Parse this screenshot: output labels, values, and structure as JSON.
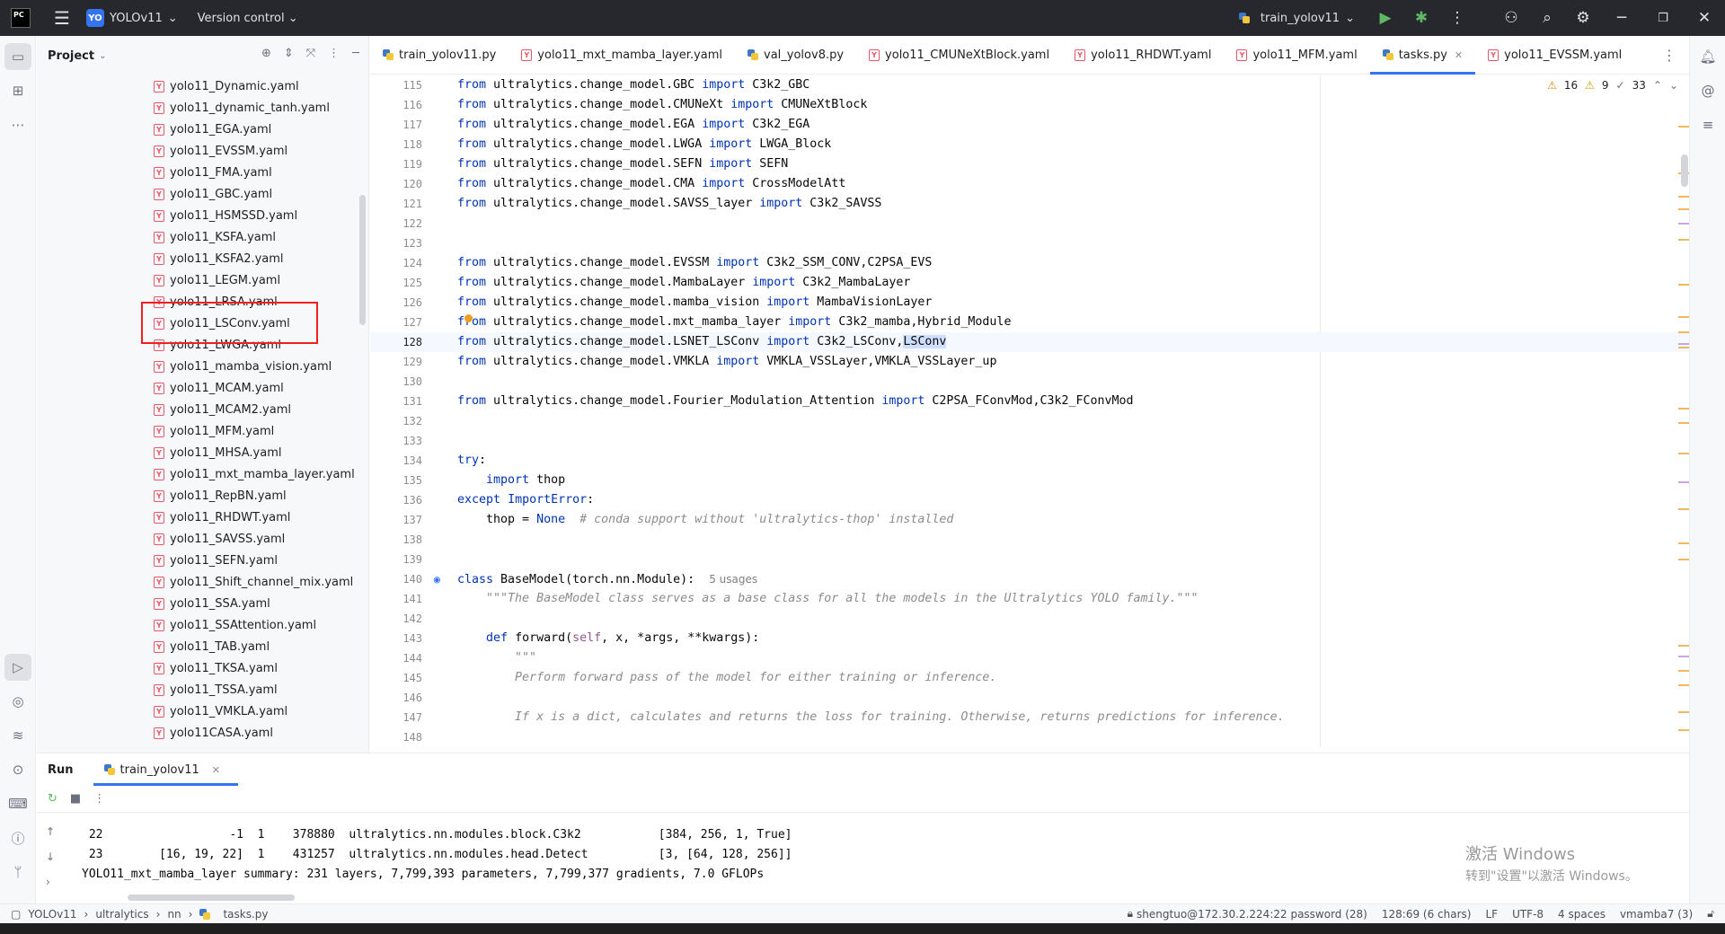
{
  "titlebar": {
    "project_badge": "YO",
    "project_name": "YOLOv11",
    "version_control": "Version control",
    "run_config": "train_yolov11"
  },
  "project_panel": {
    "title": "Project",
    "files": [
      "yolo11_Dynamic.yaml",
      "yolo11_dynamic_tanh.yaml",
      "yolo11_EGA.yaml",
      "yolo11_EVSSM.yaml",
      "yolo11_FMA.yaml",
      "yolo11_GBC.yaml",
      "yolo11_HSMSSD.yaml",
      "yolo11_KSFA.yaml",
      "yolo11_KSFA2.yaml",
      "yolo11_LEGM.yaml",
      "yolo11_LRSA.yaml",
      "yolo11_LSConv.yaml",
      "yolo11_LWGA.yaml",
      "yolo11_mamba_vision.yaml",
      "yolo11_MCAM.yaml",
      "yolo11_MCAM2.yaml",
      "yolo11_MFM.yaml",
      "yolo11_MHSA.yaml",
      "yolo11_mxt_mamba_layer.yaml",
      "yolo11_RepBN.yaml",
      "yolo11_RHDWT.yaml",
      "yolo11_SAVSS.yaml",
      "yolo11_SEFN.yaml",
      "yolo11_Shift_channel_mix.yaml",
      "yolo11_SSA.yaml",
      "yolo11_SSAttention.yaml",
      "yolo11_TAB.yaml",
      "yolo11_TKSA.yaml",
      "yolo11_TSSA.yaml",
      "yolo11_VMKLA.yaml",
      "yolo11CASA.yaml"
    ]
  },
  "tabs": [
    {
      "label": "train_yolov11.py",
      "kind": "py"
    },
    {
      "label": "yolo11_mxt_mamba_layer.yaml",
      "kind": "yaml"
    },
    {
      "label": "val_yolov8.py",
      "kind": "py"
    },
    {
      "label": "yolo11_CMUNeXtBlock.yaml",
      "kind": "yaml"
    },
    {
      "label": "yolo11_RHDWT.yaml",
      "kind": "yaml"
    },
    {
      "label": "yolo11_MFM.yaml",
      "kind": "yaml"
    },
    {
      "label": "tasks.py",
      "kind": "py",
      "active": true
    },
    {
      "label": "yolo11_EVSSM.yaml",
      "kind": "yaml"
    }
  ],
  "inspections": {
    "warnings": "16",
    "weak_warnings": "9",
    "typos": "33"
  },
  "editor": {
    "current_line": 128,
    "lines": [
      {
        "n": 115,
        "html": "<span class='kw'>from</span> ultralytics.change_model.GBC <span class='kw'>import</span> C3k2_GBC"
      },
      {
        "n": 116,
        "html": "<span class='kw'>from</span> ultralytics.change_model.CMUNeXt <span class='kw'>import</span> CMUNeXtBlock"
      },
      {
        "n": 117,
        "html": "<span class='kw'>from</span> ultralytics.change_model.EGA <span class='kw'>import</span> C3k2_EGA"
      },
      {
        "n": 118,
        "html": "<span class='kw'>from</span> ultralytics.change_model.LWGA <span class='kw'>import</span> LWGA_Block"
      },
      {
        "n": 119,
        "html": "<span class='kw'>from</span> ultralytics.change_model.SEFN <span class='kw'>import</span> SEFN"
      },
      {
        "n": 120,
        "html": "<span class='kw'>from</span> ultralytics.change_model.CMA <span class='kw'>import</span> CrossModelAtt"
      },
      {
        "n": 121,
        "html": "<span class='kw'>from</span> ultralytics.change_model.SAVSS_layer <span class='kw'>import</span> C3k2_SAVSS"
      },
      {
        "n": 122,
        "html": ""
      },
      {
        "n": 123,
        "html": ""
      },
      {
        "n": 124,
        "html": "<span class='kw'>from</span> ultralytics.change_model.EVSSM <span class='kw'>import</span> C3k2_SSM_CONV,C2PSA_EVS"
      },
      {
        "n": 125,
        "html": "<span class='kw'>from</span> ultralytics.change_model.MambaLayer <span class='kw'>import</span> C3k2_MambaLayer"
      },
      {
        "n": 126,
        "html": "<span class='kw'>from</span> ultralytics.change_model.mamba_vision <span class='kw'>import</span> MambaVisionLayer"
      },
      {
        "n": 127,
        "html": "<span class='kw'>from</span> ultralytics.change_model.mxt_mamba_layer <span class='kw'>import</span> C3k2_mamba,Hybrid_Module"
      },
      {
        "n": 128,
        "html": "<span class='kw'>from</span> ultralytics.change_model.LSNET_LSConv <span class='kw'>import</span> C3k2_LSConv,<span class='sel'>LSConv</span>"
      },
      {
        "n": 129,
        "html": "<span class='kw'>from</span> ultralytics.change_model.VMKLA <span class='kw'>import</span> VMKLA_VSSLayer,VMKLA_VSSLayer_up"
      },
      {
        "n": 130,
        "html": ""
      },
      {
        "n": 131,
        "html": "<span class='kw'>from</span> ultralytics.change_model.Fourier_Modulation_Attention <span class='kw'>import</span> C2PSA_FConvMod,C3k2_FConvMod"
      },
      {
        "n": 132,
        "html": ""
      },
      {
        "n": 133,
        "html": ""
      },
      {
        "n": 134,
        "html": "<span class='kw'>try</span>:"
      },
      {
        "n": 135,
        "html": "    <span class='kw'>import</span> thop"
      },
      {
        "n": 136,
        "html": "<span class='kw'>except</span> <span class='kw'>ImportError</span>:"
      },
      {
        "n": 137,
        "html": "    thop = <span class='kw'>None</span>  <span class='cm'># conda support without 'ultralytics-thop' installed</span>"
      },
      {
        "n": 138,
        "html": ""
      },
      {
        "n": 139,
        "html": ""
      },
      {
        "n": 140,
        "html": "<span class='kw'>class</span> BaseModel(torch.nn.Module):  <span class='hint'>5 usages</span>"
      },
      {
        "n": 141,
        "html": "    <span class='cm'>\"\"\"The BaseModel class serves as a base class for all the models in the Ultralytics YOLO family.\"\"\"</span>"
      },
      {
        "n": 142,
        "html": ""
      },
      {
        "n": 143,
        "html": "    <span class='kw'>def</span> forward(<span class='pm'>self</span>, x, *args, **kwargs):"
      },
      {
        "n": 144,
        "html": "        <span class='cm'>\"\"\"</span>"
      },
      {
        "n": 145,
        "html": "        <span class='cm'>Perform forward pass of the model for either training or inference.</span>"
      },
      {
        "n": 146,
        "html": ""
      },
      {
        "n": 147,
        "html": "        <span class='cm'>If x is a dict, calculates and returns the loss for training. Otherwise, returns predictions for inference.</span>"
      },
      {
        "n": 148,
        "html": ""
      }
    ]
  },
  "run_panel": {
    "title": "Run",
    "tab": "train_yolov11",
    "output": [
      " 22                  -1  1    378880  ultralytics.nn.modules.block.C3k2           [384, 256, 1, True]",
      " 23        [16, 19, 22]  1    431257  ultralytics.nn.modules.head.Detect          [3, [64, 128, 256]]",
      "YOLO11_mxt_mamba_layer summary: 231 layers, 7,799,393 parameters, 7,799,377 gradients, 7.0 GFLOPs"
    ],
    "watermark_line1": "激活 Windows",
    "watermark_line2": "转到\"设置\"以激活 Windows。"
  },
  "statusbar": {
    "crumbs": [
      "YOLOv11",
      "ultralytics",
      "nn",
      "tasks.py"
    ],
    "interpreter": "shengtuo@172.30.2.224:22 password (28)",
    "position": "128:69 (6 chars)",
    "line_sep": "LF",
    "encoding": "UTF-8",
    "indent": "4 spaces",
    "env": "vmamba7 (3)"
  }
}
